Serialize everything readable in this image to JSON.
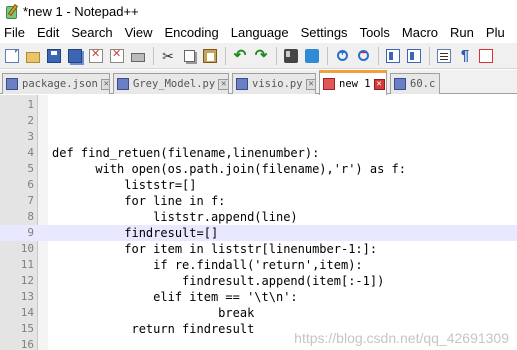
{
  "window": {
    "title": "*new 1 - Notepad++"
  },
  "menu": [
    "File",
    "Edit",
    "Search",
    "View",
    "Encoding",
    "Language",
    "Settings",
    "Tools",
    "Macro",
    "Run",
    "Plu"
  ],
  "toolbar": {
    "icons": [
      "new-file-icon",
      "open-file-icon",
      "save-icon",
      "save-all-icon",
      "close-icon",
      "close-all-icon",
      "print-icon",
      "cut-icon",
      "copy-icon",
      "paste-icon",
      "undo-icon",
      "redo-icon",
      "find-icon",
      "replace-icon",
      "zoom-in-icon",
      "zoom-out-icon",
      "sync-scroll-icon",
      "sync-h-icon",
      "word-wrap-icon",
      "show-all-chars-icon",
      "indent-guide-icon"
    ]
  },
  "tabs": [
    {
      "label": "package.json",
      "active": false,
      "icon_color": "#6a7fc4"
    },
    {
      "label": "Grey_Model.py",
      "active": false,
      "icon_color": "#6a7fc4"
    },
    {
      "label": "visio.py",
      "active": false,
      "icon_color": "#6a7fc4"
    },
    {
      "label": "new 1",
      "active": true,
      "icon_color": "#e25757"
    },
    {
      "label": "60.c",
      "active": false,
      "icon_color": "#6a7fc4"
    }
  ],
  "editor": {
    "current_line": 8,
    "lines": [
      {
        "n": "1",
        "text": ""
      },
      {
        "n": "2",
        "text": ""
      },
      {
        "n": "3",
        "text": ""
      },
      {
        "n": "4",
        "text": "def find_retuen(filename,linenumber):"
      },
      {
        "n": "5",
        "text": "      with open(os.path.join(filename),'r') as f:"
      },
      {
        "n": "6",
        "text": "          liststr=[]"
      },
      {
        "n": "7",
        "text": "          for line in f:"
      },
      {
        "n": "8",
        "text": "              liststr.append(line)"
      },
      {
        "n": "9",
        "text": "          findresult=[]"
      },
      {
        "n": "10",
        "text": "          for item in liststr[linenumber-1:]:"
      },
      {
        "n": "11",
        "text": "              if re.findall('return',item):"
      },
      {
        "n": "12",
        "text": "                  findresult.append(item[:-1])"
      },
      {
        "n": "13",
        "text": "              elif item == '\\t\\n':"
      },
      {
        "n": "14",
        "text": "                       break"
      },
      {
        "n": "15",
        "text": "           return findresult"
      },
      {
        "n": "16",
        "text": ""
      }
    ]
  },
  "watermark": "https://blog.csdn.net/qq_42691309"
}
